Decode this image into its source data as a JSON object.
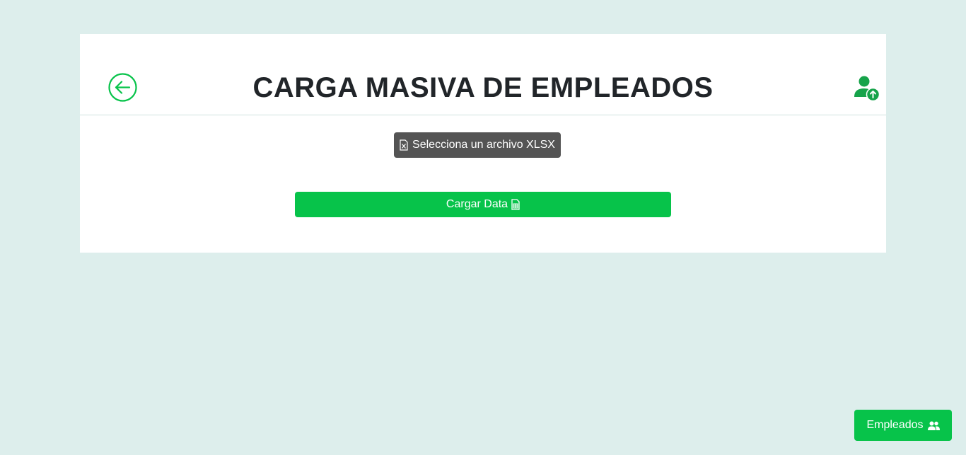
{
  "header": {
    "title": "CARGA MASIVA DE EMPLEADOS",
    "back_icon": "arrow-left-circle-icon",
    "user_icon": "user-upload-icon"
  },
  "form": {
    "file_select_label": "Selecciona un archivo XLSX",
    "file_icon": "file-excel-icon",
    "upload_label": "Cargar Data",
    "upload_icon": "file-spreadsheet-icon"
  },
  "fab": {
    "label": "Empleados",
    "icon": "people-icon"
  },
  "colors": {
    "background": "#ddeeec",
    "accent": "#07c34a",
    "dark_button": "#545454"
  }
}
